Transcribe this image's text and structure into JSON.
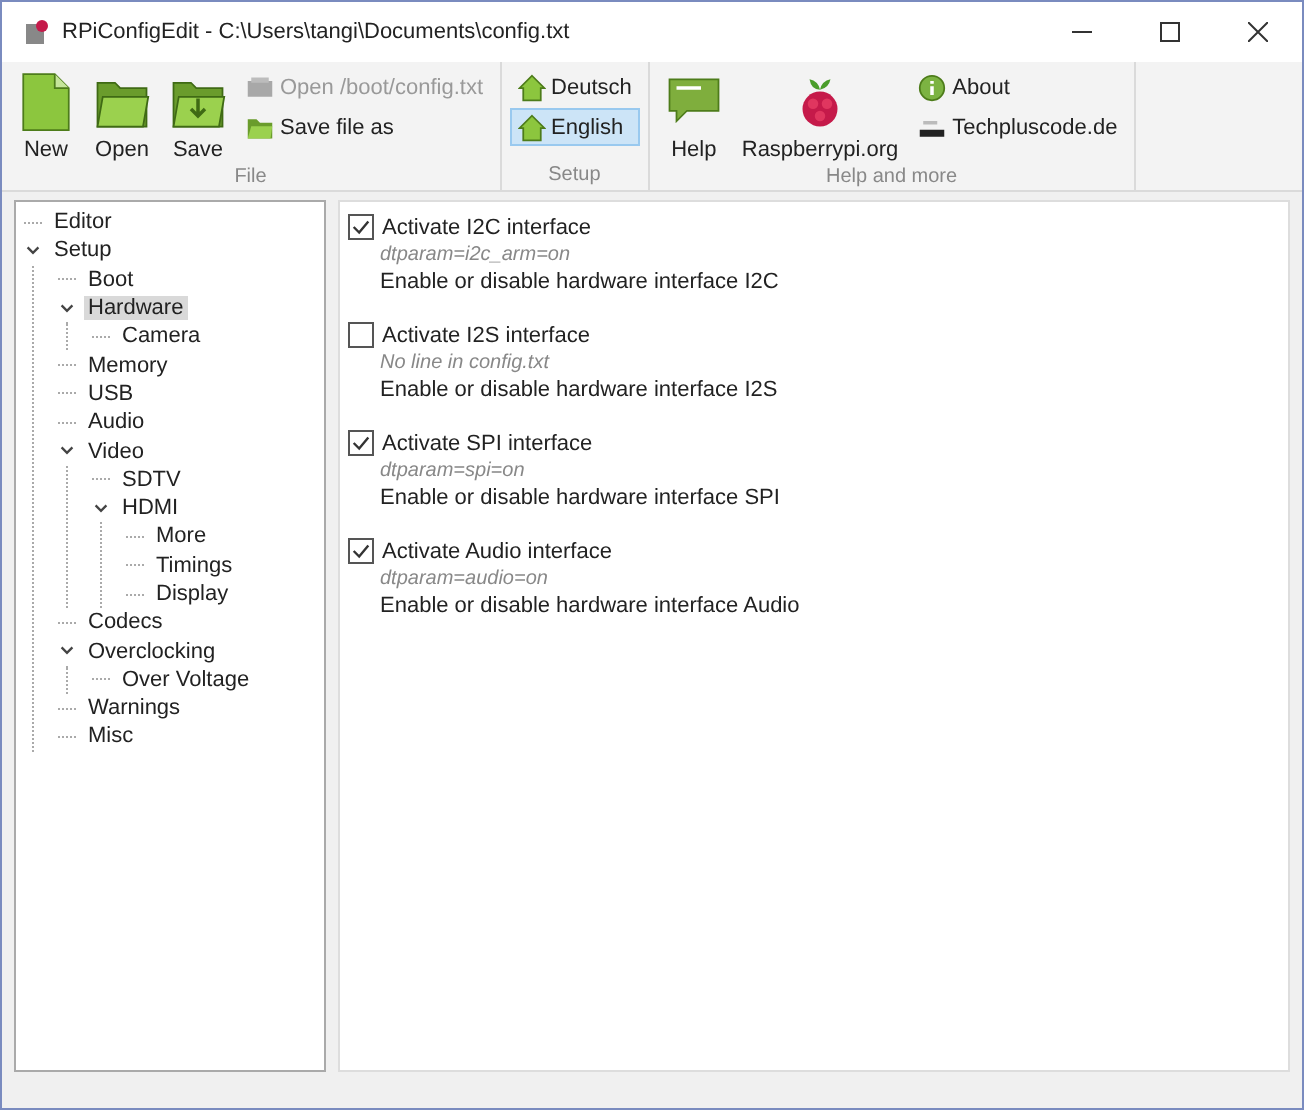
{
  "window": {
    "title": "RPiConfigEdit - C:\\Users\\tangi\\Documents\\config.txt"
  },
  "ribbon": {
    "groups": [
      {
        "label": "File",
        "large": [
          {
            "label": "New",
            "kind": "new"
          },
          {
            "label": "Open",
            "kind": "open"
          },
          {
            "label": "Save",
            "kind": "save"
          }
        ],
        "small": [
          {
            "label": "Open /boot/config.txt",
            "kind": "device",
            "disabled": true,
            "selected": false
          },
          {
            "label": "Save file as",
            "kind": "saveas",
            "disabled": false,
            "selected": false
          }
        ]
      },
      {
        "label": "Setup",
        "small": [
          {
            "label": "Deutsch",
            "kind": "home",
            "disabled": false,
            "selected": false
          },
          {
            "label": "English",
            "kind": "home",
            "disabled": false,
            "selected": true
          }
        ]
      },
      {
        "label": "Help and more",
        "large": [
          {
            "label": "Help",
            "kind": "help"
          },
          {
            "label": "Raspberrypi.org",
            "kind": "berry"
          }
        ],
        "small": [
          {
            "label": "About",
            "kind": "info",
            "disabled": false,
            "selected": false
          },
          {
            "label": "Techpluscode.de",
            "kind": "code",
            "disabled": false,
            "selected": false
          }
        ]
      }
    ]
  },
  "tree": [
    {
      "label": "Editor",
      "selected": false
    },
    {
      "label": "Setup",
      "selected": false,
      "expanded": true,
      "children": [
        {
          "label": "Boot",
          "selected": false
        },
        {
          "label": "Hardware",
          "selected": true,
          "expanded": true,
          "children": [
            {
              "label": "Camera",
              "selected": false
            }
          ]
        },
        {
          "label": "Memory",
          "selected": false
        },
        {
          "label": "USB",
          "selected": false
        },
        {
          "label": "Audio",
          "selected": false
        },
        {
          "label": "Video",
          "selected": false,
          "expanded": true,
          "children": [
            {
              "label": "SDTV",
              "selected": false
            },
            {
              "label": "HDMI",
              "selected": false,
              "expanded": true,
              "children": [
                {
                  "label": "More",
                  "selected": false
                },
                {
                  "label": "Timings",
                  "selected": false
                },
                {
                  "label": "Display",
                  "selected": false
                }
              ]
            }
          ]
        },
        {
          "label": "Codecs",
          "selected": false
        },
        {
          "label": "Overclocking",
          "selected": false,
          "expanded": true,
          "children": [
            {
              "label": "Over Voltage",
              "selected": false
            }
          ]
        },
        {
          "label": "Warnings",
          "selected": false
        },
        {
          "label": "Misc",
          "selected": false
        }
      ]
    }
  ],
  "options": [
    {
      "label": "Activate I2C interface",
      "checked": true,
      "param": "dtparam=i2c_arm=on",
      "description": "Enable or disable hardware interface I2C"
    },
    {
      "label": "Activate I2S interface",
      "checked": false,
      "param": "No line in config.txt",
      "description": "Enable or disable hardware interface I2S"
    },
    {
      "label": "Activate SPI interface",
      "checked": true,
      "param": "dtparam=spi=on",
      "description": "Enable or disable hardware interface SPI"
    },
    {
      "label": "Activate Audio interface",
      "checked": true,
      "param": "dtparam=audio=on",
      "description": "Enable or disable hardware interface Audio"
    }
  ]
}
